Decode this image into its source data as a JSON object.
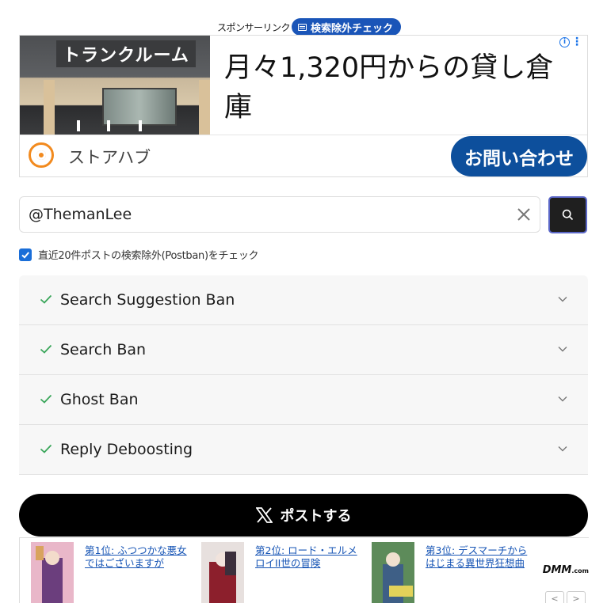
{
  "sponsor": {
    "label": "スポンサーリンク",
    "pill_label": "検索除外チェック"
  },
  "ad": {
    "photo_sign": "トランクルーム",
    "headline": "月々1,320円からの貸し倉庫",
    "brand": "ストアハブ",
    "cta": "お問い合わせ",
    "info_glyph": "i",
    "menu_glyph": "⋮"
  },
  "search": {
    "value": "@ThemanLee",
    "placeholder": ""
  },
  "postban_check": {
    "label": "直近20件ポストの検索除外(Postban)をチェック",
    "checked": true
  },
  "checks": [
    {
      "label": "Search Suggestion Ban",
      "status": "ok"
    },
    {
      "label": "Search Ban",
      "status": "ok"
    },
    {
      "label": "Ghost Ban",
      "status": "ok"
    },
    {
      "label": "Reply Deboosting",
      "status": "ok"
    }
  ],
  "post_button": {
    "label": "ポストする",
    "icon": "x-logo-icon"
  },
  "ranking": {
    "items": [
      {
        "title": "第1位: ふつつかな悪女ではございますが",
        "cover_colors": [
          "#e9b7c9",
          "#6b3e7d",
          "#d9a35e"
        ]
      },
      {
        "title": "第2位: ロード・エルメロイII世の冒険",
        "cover_colors": [
          "#e7e0de",
          "#8c1f2c",
          "#3b2f3c"
        ]
      },
      {
        "title": "第3位: デスマーチからはじまる異世界狂想曲",
        "cover_colors": [
          "#5d8b5a",
          "#3e5f86",
          "#e2d25a"
        ]
      }
    ],
    "brand": "DMM",
    "brand_suffix": ".com",
    "prev": "<",
    "next": ">"
  },
  "colors": {
    "accent_blue": "#1a55b8",
    "cta_blue": "#0d4f9c",
    "check_green": "#3aa65a",
    "post_black": "#000000",
    "link_blue": "#1654b5"
  }
}
